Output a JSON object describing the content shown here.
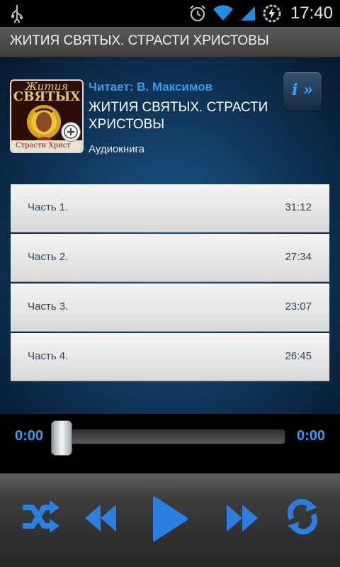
{
  "status_bar": {
    "time": "17:40",
    "icons": [
      "usb-icon",
      "alarm-icon",
      "wifi-icon",
      "signal-icon",
      "battery-charging-icon"
    ]
  },
  "app": {
    "title": "ЖИТИЯ СВЯТЫХ. СТРАСТИ ХРИСТОВЫ"
  },
  "book": {
    "cover_line1": "Жития",
    "cover_line2": "СВЯТЫХ",
    "cover_line3": "Страсти Христ",
    "reader": "Читает: В. Максимов",
    "title": "ЖИТИЯ СВЯТЫХ. СТРАСТИ ХРИСТОВЫ",
    "type": "Аудиокнига",
    "info_label": "i »"
  },
  "tracks": [
    {
      "name": "Часть 1.",
      "duration": "31:12"
    },
    {
      "name": "Часть 2.",
      "duration": "27:34"
    },
    {
      "name": "Часть 3.",
      "duration": "23:07"
    },
    {
      "name": "Часть 4.",
      "duration": "26:45"
    }
  ],
  "player": {
    "current_time": "0:00",
    "total_time": "0:00",
    "progress": 0,
    "controls": [
      "shuffle-icon",
      "rewind-icon",
      "play-icon",
      "fast-forward-icon",
      "repeat-icon"
    ],
    "accent": "#2a7fe0"
  }
}
